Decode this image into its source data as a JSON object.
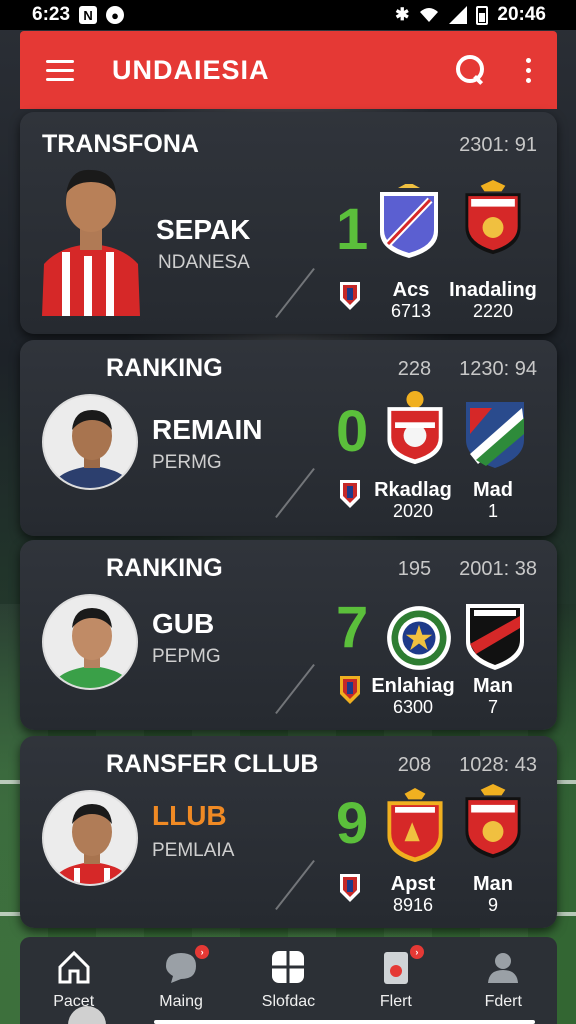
{
  "status_bar": {
    "time": "6:23",
    "right_text": "20:46"
  },
  "header": {
    "title": "UNDAIESIA"
  },
  "cards": [
    {
      "title": "TRANSFONA",
      "meta": [
        "2301: 91"
      ],
      "player_name": "SEPAK",
      "player_sub": "NDANESA",
      "score": "1",
      "team_a": {
        "name": "Acs",
        "value": "6713"
      },
      "team_b": {
        "name": "Inadaling",
        "value": "2220"
      }
    },
    {
      "title": "RANKING",
      "meta": [
        "228",
        "1230: 94"
      ],
      "player_name": "REMAIN",
      "player_sub": "PERMG",
      "score": "0",
      "team_a": {
        "name": "Rkadlag",
        "value": "2020"
      },
      "team_b": {
        "name": "Mad",
        "value": "1"
      }
    },
    {
      "title": "RANKING",
      "meta": [
        "195",
        "2001: 38"
      ],
      "player_name": "GUB",
      "player_sub": "PEPMG",
      "score": "7",
      "team_a": {
        "name": "Enlahiag",
        "value": "6300"
      },
      "team_b": {
        "name": "Man",
        "value": "7"
      }
    },
    {
      "title": "RANSFER CLLUB",
      "meta": [
        "208",
        "1028: 43"
      ],
      "player_name": "LLUB",
      "player_sub": "PEMLAIA",
      "score": "9",
      "team_a": {
        "name": "Apst",
        "value": "8916"
      },
      "team_b": {
        "name": "Man",
        "value": "9"
      }
    }
  ],
  "nav": [
    {
      "label": "Pacet",
      "icon": "home-icon"
    },
    {
      "label": "Maing",
      "icon": "chat-icon"
    },
    {
      "label": "Slofdac",
      "icon": "grid-icon"
    },
    {
      "label": "Flert",
      "icon": "card-icon"
    },
    {
      "label": "Fdert",
      "icon": "profile-icon"
    }
  ],
  "colors": {
    "accent": "#e53935",
    "score_green": "#5bbf3b",
    "card_bg": "#2d3137"
  }
}
